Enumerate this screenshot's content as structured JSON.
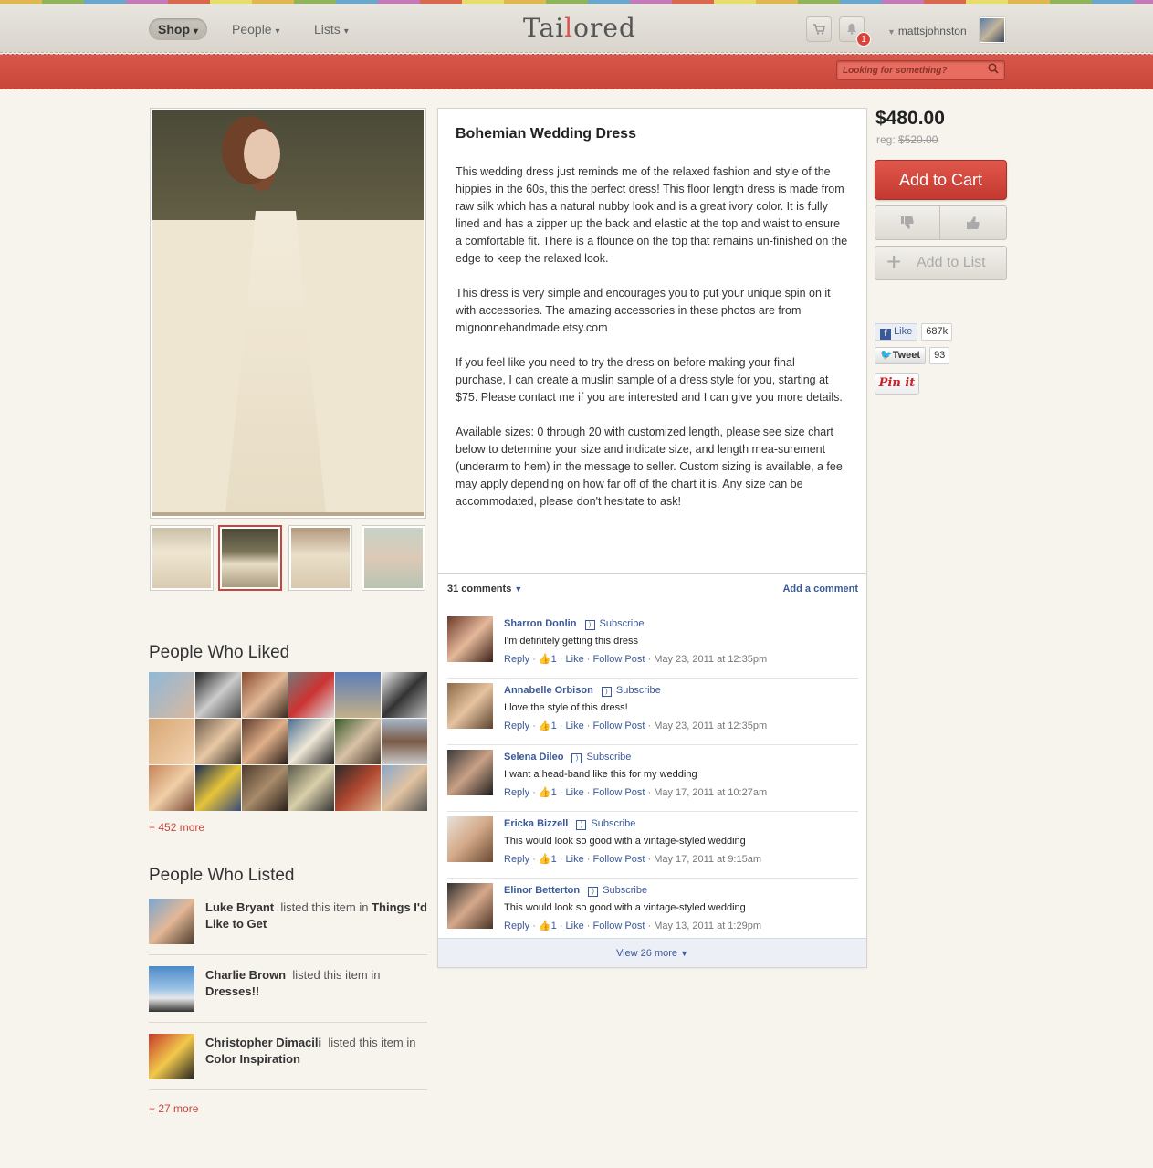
{
  "header": {
    "nav": [
      {
        "label": "Shop",
        "caret": "▾"
      },
      {
        "label": "People",
        "caret": "▾"
      },
      {
        "label": "Lists",
        "caret": "▾"
      }
    ],
    "logo": {
      "pre": "Tai",
      "accent": "l",
      "post": "ored"
    },
    "notification_count": "1",
    "username": "mattsjohnston",
    "icons": {
      "cart": "cart-icon",
      "notifications": "bell-icon"
    }
  },
  "search": {
    "placeholder": "Looking for something?"
  },
  "product": {
    "title": "Bohemian Wedding Dress",
    "description": [
      "This wedding dress just reminds me of the relaxed fashion and style of the hippies in the 60s, this the perfect dress! This floor length dress is made from raw silk which has a natural nubby look and is a great ivory color. It is fully lined and has a zipper up the back and elastic at the top and waist to ensure a comfortable fit. There is a flounce on the top that remains un-finished on the edge to keep the relaxed look.",
      "This dress is very simple and encourages you to put your unique spin on it with accessories. The amazing accessories in these photos are from mignonnehandmade.etsy.com",
      "If you feel like you need to try the dress on before making your final purchase, I can create a muslin sample of a dress style for you, starting at $75. Please contact me if you are interested and I can give you more details.",
      "Available sizes: 0 through 20 with customized length, please see size chart below to determine your size and indicate size, and length mea-surement (underarm to hem) in the message to seller. Custom sizing is available, a fee may apply depending on how far off of the chart it is. Any size can be accommodated, please don't hesitate to ask!"
    ],
    "price": "$480.00",
    "reg_label": "reg:",
    "reg_price": "$520.00",
    "add_to_cart": "Add to Cart",
    "add_to_list": "Add to List"
  },
  "social": {
    "like_label": "Like",
    "like_count": "687k",
    "tweet_label": "Tweet",
    "tweet_count": "93",
    "pin_label": "Pin it"
  },
  "people_liked": {
    "title": "People Who Liked",
    "more": "+ 452 more"
  },
  "people_listed": {
    "title": "People Who Listed",
    "verb": "listed this item in",
    "items": [
      {
        "name": "Luke Bryant",
        "list": "Things I'd Like to Get"
      },
      {
        "name": "Charlie Brown",
        "list": "Dresses!!"
      },
      {
        "name": "Christopher Dimacili",
        "list": "Color Inspiration"
      }
    ],
    "more": "+ 27 more"
  },
  "comments": {
    "count_label": "31 comments",
    "add_label": "Add a comment",
    "subscribe": "Subscribe",
    "reply": "Reply",
    "like_count": "1",
    "like": "Like",
    "follow": "Follow Post",
    "items": [
      {
        "name": "Sharron Donlin",
        "text": "I'm definitely getting this dress",
        "date": "May 23, 2011 at 12:35pm"
      },
      {
        "name": "Annabelle Orbison",
        "text": "I love the style of this dress!",
        "date": "May 23, 2011 at 12:35pm"
      },
      {
        "name": "Selena Dileo",
        "text": "I want a head-band like this for my wedding",
        "date": "May 17, 2011 at 10:27am"
      },
      {
        "name": "Ericka Bizzell",
        "text": "This would look so good with a vintage-styled wedding",
        "date": "May 17, 2011 at 9:15am"
      },
      {
        "name": "Elinor Betterton",
        "text": "This would look so good with a vintage-styled wedding",
        "date": "May 13, 2011 at 1:29pm"
      }
    ],
    "view_more": "View 26 more"
  }
}
